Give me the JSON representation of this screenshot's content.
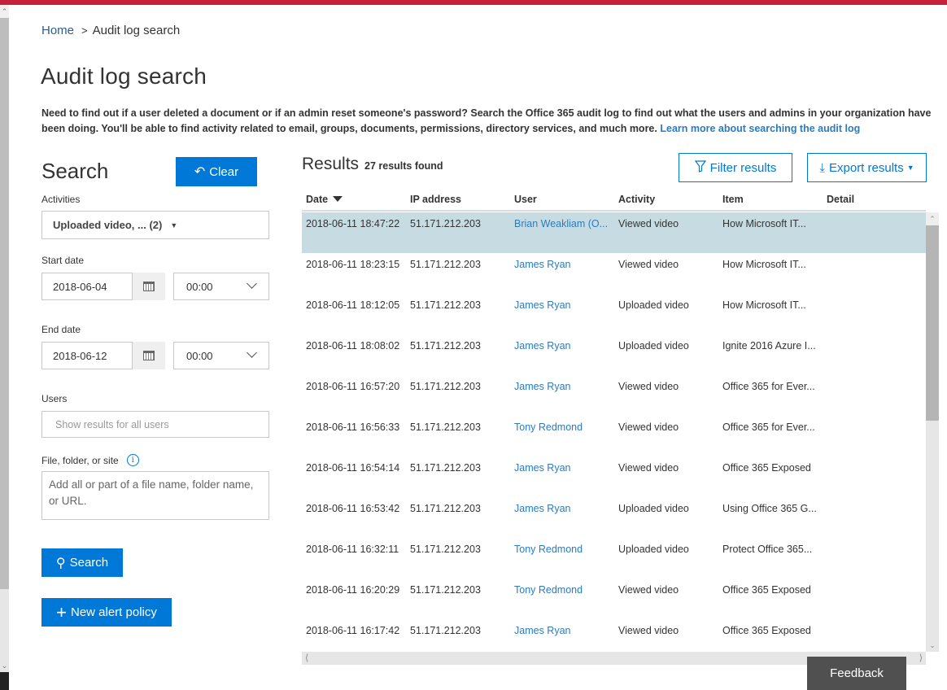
{
  "breadcrumb": {
    "home": "Home",
    "separator": ">",
    "current": "Audit log search"
  },
  "page": {
    "title": "Audit log search",
    "intro": "Need to find out if a user deleted a document or if an admin reset someone's password? Search the Office 365 audit log to find out what the users and admins in your organization have been doing. You'll be able to find activity related to email, groups, documents, permissions, directory services, and much more.",
    "learn_more_link": "Learn more about searching the audit log"
  },
  "search": {
    "heading": "Search",
    "clear_label": "Clear",
    "activities_label": "Activities",
    "activities_value": "Uploaded video, ... (2)",
    "start_date_label": "Start date",
    "start_date": "2018-06-04",
    "start_time": "00:00",
    "end_date_label": "End date",
    "end_date": "2018-06-12",
    "end_time": "00:00",
    "users_label": "Users",
    "users_placeholder": "Show results for all users",
    "file_label": "File, folder, or site",
    "file_placeholder": "Add all or part of a file name, folder name, or URL.",
    "search_label": "Search",
    "new_alert_label": "New alert policy"
  },
  "results": {
    "heading": "Results",
    "count": "27 results found",
    "filter_label": "Filter results",
    "export_label": "Export results",
    "columns": [
      "Date",
      "IP address",
      "User",
      "Activity",
      "Item",
      "Detail"
    ],
    "rows": [
      {
        "date": "2018-06-11 18:47:22",
        "ip": "51.171.212.203",
        "user": "Brian Weakliam (O...",
        "activity": "Viewed video",
        "item": "How Microsoft IT...",
        "detail": "",
        "selected": true
      },
      {
        "date": "2018-06-11 18:23:15",
        "ip": "51.171.212.203",
        "user": "James Ryan",
        "activity": "Viewed video",
        "item": "How Microsoft IT...",
        "detail": ""
      },
      {
        "date": "2018-06-11 18:12:05",
        "ip": "51.171.212.203",
        "user": "James Ryan",
        "activity": "Uploaded video",
        "item": "How Microsoft IT...",
        "detail": ""
      },
      {
        "date": "2018-06-11 18:08:02",
        "ip": "51.171.212.203",
        "user": "James Ryan",
        "activity": "Uploaded video",
        "item": "Ignite 2016 Azure I...",
        "detail": ""
      },
      {
        "date": "2018-06-11 16:57:20",
        "ip": "51.171.212.203",
        "user": "James Ryan",
        "activity": "Viewed video",
        "item": "Office 365 for Ever...",
        "detail": ""
      },
      {
        "date": "2018-06-11 16:56:33",
        "ip": "51.171.212.203",
        "user": "Tony Redmond",
        "activity": "Viewed video",
        "item": "Office 365 for Ever...",
        "detail": ""
      },
      {
        "date": "2018-06-11 16:54:14",
        "ip": "51.171.212.203",
        "user": "James Ryan",
        "activity": "Viewed video",
        "item": "Office 365 Exposed",
        "detail": ""
      },
      {
        "date": "2018-06-11 16:53:42",
        "ip": "51.171.212.203",
        "user": "James Ryan",
        "activity": "Uploaded video",
        "item": "Using Office 365 G...",
        "detail": ""
      },
      {
        "date": "2018-06-11 16:32:11",
        "ip": "51.171.212.203",
        "user": "Tony Redmond",
        "activity": "Uploaded video",
        "item": "Protect Office 365...",
        "detail": ""
      },
      {
        "date": "2018-06-11 16:20:29",
        "ip": "51.171.212.203",
        "user": "Tony Redmond",
        "activity": "Viewed video",
        "item": "Office 365 Exposed",
        "detail": ""
      },
      {
        "date": "2018-06-11 16:17:42",
        "ip": "51.171.212.203",
        "user": "James Ryan",
        "activity": "Viewed video",
        "item": "Office 365 Exposed",
        "detail": ""
      }
    ]
  },
  "feedback_label": "Feedback",
  "colors": {
    "accent": "#0078d7",
    "top_bar": "#c4223a",
    "link": "#2b7bbf",
    "selected_row": "#c7dce2"
  }
}
